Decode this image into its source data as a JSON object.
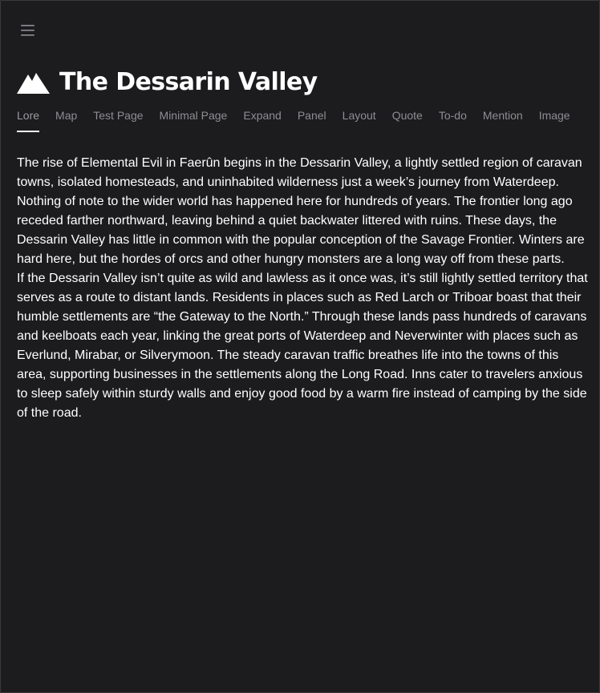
{
  "menu": {
    "icon": "hamburger-menu-icon"
  },
  "header": {
    "logo_icon": "mountain-icon",
    "title": "The Dessarin Valley"
  },
  "tabs": [
    {
      "label": "Lore",
      "active": true
    },
    {
      "label": "Map",
      "active": false
    },
    {
      "label": "Test Page",
      "active": false
    },
    {
      "label": "Minimal Page",
      "active": false
    },
    {
      "label": "Expand",
      "active": false
    },
    {
      "label": "Panel",
      "active": false
    },
    {
      "label": "Layout",
      "active": false
    },
    {
      "label": "Quote",
      "active": false
    },
    {
      "label": "To-do",
      "active": false
    },
    {
      "label": "Mention",
      "active": false
    },
    {
      "label": "Image",
      "active": false
    }
  ],
  "content": {
    "paragraphs": [
      "The rise of Elemental Evil in Faerûn begins in the Dessarin Valley, a lightly settled region of caravan towns, isolated homesteads, and uninhabited wilderness just a week’s journey from Waterdeep. Nothing of note to the wider world has happened here for hundreds of years. The frontier long ago receded farther northward, leaving behind a quiet backwater littered with ruins. These days, the Dessarin Valley has little in common with the popular conception of the Savage Frontier. Winters are hard here, but the hordes of orcs and other hungry monsters are a long way off from these parts.",
      "If the Dessarin Valley isn’t quite as wild and lawless as it once was, it’s still lightly settled territory that serves as a route to distant lands. Residents in places such as Red Larch or Triboar boast that their humble settlements are “the Gateway to the North.” Through these lands pass hundreds of caravans and keelboats each year, linking the great ports of Waterdeep and Neverwinter with places such as Everlund, Mirabar, or Silverymoon. The steady caravan traffic breathes life into the towns of this area, supporting businesses in the settlements along the Long Road. Inns cater to travelers anxious to sleep safely within sturdy walls and enjoy good food by a warm fire instead of camping by the side of the road."
    ]
  },
  "colors": {
    "background": "#1c1c1e",
    "text": "#ffffff",
    "muted": "#8e8e93",
    "border": "#3a3a3d"
  }
}
